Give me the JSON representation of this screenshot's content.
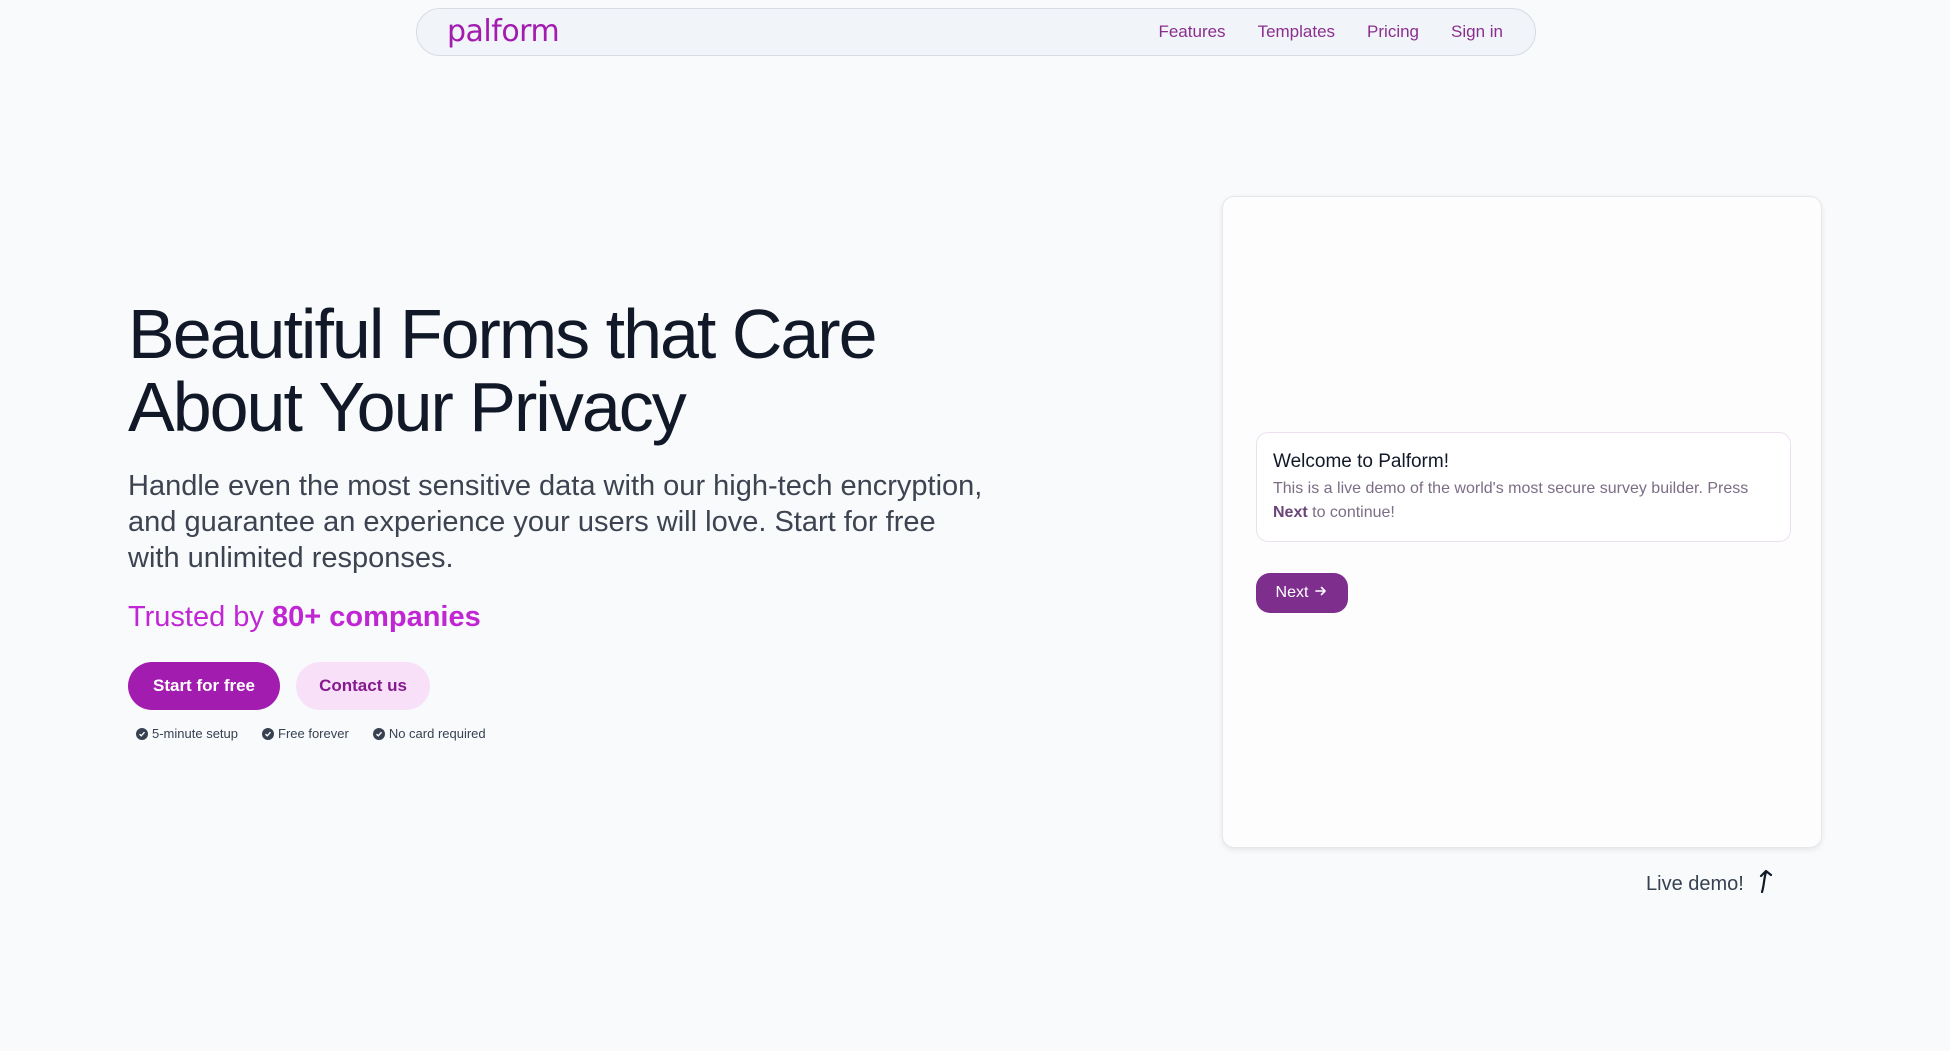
{
  "nav": {
    "logo": "palform",
    "links": [
      "Features",
      "Templates",
      "Pricing",
      "Sign in"
    ]
  },
  "hero": {
    "title_line1": "Beautiful Forms that Care",
    "title_line2_prefix": "About ",
    "title_line2_highlight": "Your Privacy",
    "subtitle": "Handle even the most sensitive data with our high-tech encryption, and guarantee an experience your users will love. Start for free with unlimited responses.",
    "trusted_prefix": "Trusted by ",
    "trusted_count": "80+ companies",
    "primary_button": "Start for free",
    "secondary_button": "Contact us",
    "perks": [
      "5-minute setup",
      "Free forever",
      "No card required"
    ]
  },
  "demo": {
    "card_title": "Welcome to Palform!",
    "card_body_prefix": "This is a live demo of the world's most secure survey builder. Press ",
    "card_body_bold": "Next",
    "card_body_suffix": " to continue!",
    "next_button": "Next",
    "caption": "Live demo!"
  },
  "colors": {
    "accent": "#a21caf",
    "accent_light": "#f8e1f8",
    "demo_button": "#7e2f8e",
    "background": "#f8fafc"
  },
  "icons": [
    "check-circle-icon",
    "arrow-right-icon",
    "curved-arrow-up-icon"
  ]
}
